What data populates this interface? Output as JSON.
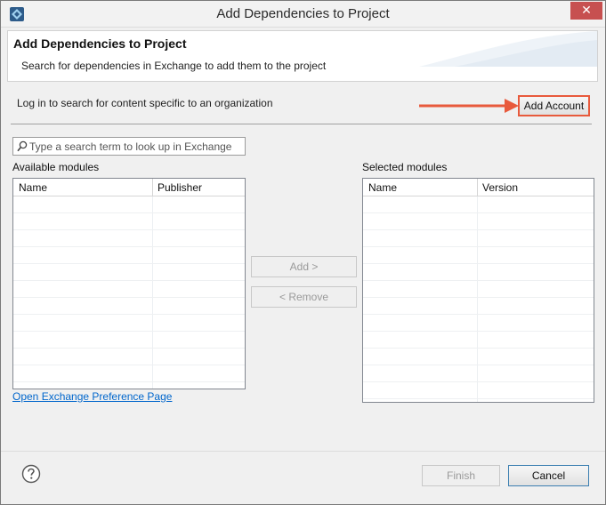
{
  "window": {
    "title": "Add Dependencies to Project",
    "close_label": "✕"
  },
  "banner": {
    "title": "Add Dependencies to Project",
    "description": "Search for dependencies in Exchange to add them to the project"
  },
  "login": {
    "text": "Log in to search for content specific to an organization",
    "button_label": "Add Account"
  },
  "search": {
    "placeholder": "Type a search term to look up in Exchange",
    "value": ""
  },
  "available": {
    "label": "Available modules",
    "columns": [
      "Name",
      "Publisher"
    ],
    "rows": []
  },
  "selected": {
    "label": "Selected modules",
    "columns": [
      "Name",
      "Version"
    ],
    "rows": []
  },
  "actions": {
    "add_label": "Add >",
    "remove_label": "< Remove"
  },
  "preference_link": "Open Exchange Preference Page",
  "footer": {
    "finish_label": "Finish",
    "cancel_label": "Cancel"
  },
  "colors": {
    "close": "#c75050",
    "arrow": "#e85a3c",
    "link": "#0066cc",
    "primary_border": "#3c7fb1"
  },
  "icons": {
    "app": "eclipse-app-icon",
    "search": "search-icon",
    "help": "help-icon",
    "close": "close-icon",
    "arrow": "red-arrow-annotation"
  }
}
